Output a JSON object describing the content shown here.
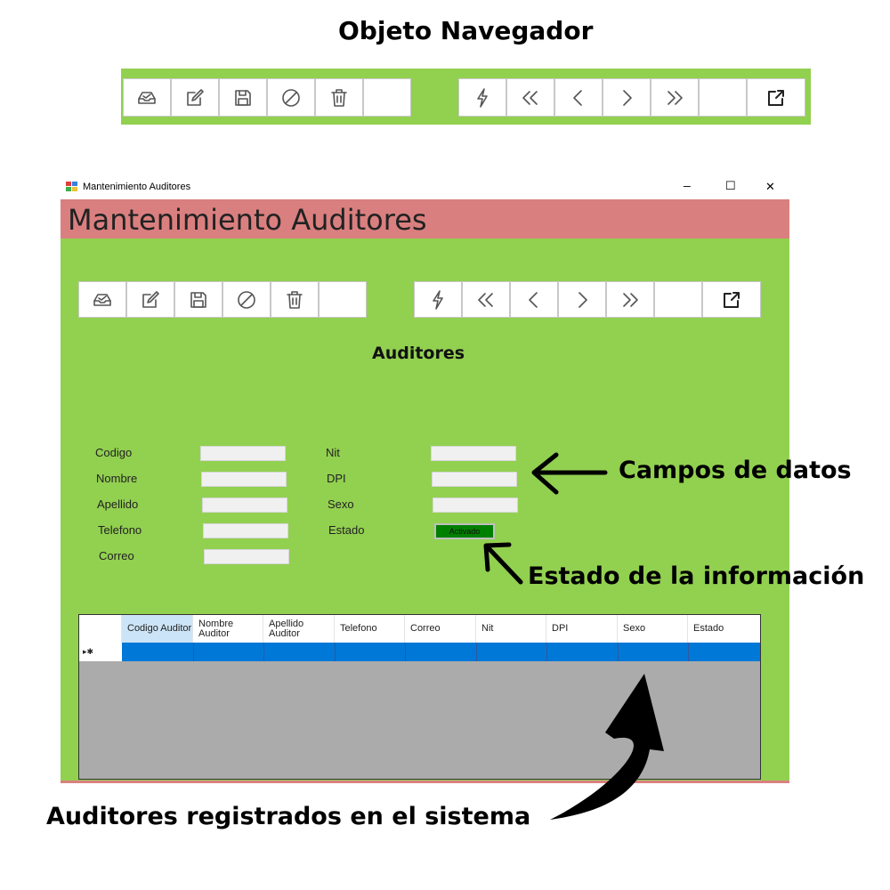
{
  "annotations": {
    "navigator_title": "Objeto Navegador",
    "fields_label": "Campos de datos",
    "state_label": "Estado de la información",
    "grid_label": "Auditores registrados en el sistema"
  },
  "toolbar": {
    "left_buttons": [
      {
        "icon": "inbox-icon"
      },
      {
        "icon": "edit-icon"
      },
      {
        "icon": "save-icon"
      },
      {
        "icon": "cancel-icon"
      },
      {
        "icon": "trash-icon"
      },
      {
        "icon": ""
      }
    ],
    "right_buttons": [
      {
        "icon": "refresh-icon"
      },
      {
        "icon": "first-icon"
      },
      {
        "icon": "previous-icon"
      },
      {
        "icon": "next-icon"
      },
      {
        "icon": "last-icon"
      },
      {
        "icon": ""
      },
      {
        "icon": "external-link-icon"
      }
    ]
  },
  "window": {
    "title": "Mantenimiento Auditores",
    "header_title": "Mantenimiento Auditores",
    "section_title": "Auditores",
    "controls": {
      "minimize": "–",
      "maximize": "☐",
      "close": "✕"
    }
  },
  "form": {
    "left_labels": [
      "Codigo",
      "Nombre",
      "Apellido",
      "Telefono",
      "Correo"
    ],
    "right_labels": [
      "Nit",
      "DPI",
      "Sexo",
      "Estado"
    ],
    "estado_button": "Activado"
  },
  "grid": {
    "columns": [
      "Codigo Auditor",
      "Nombre Auditor",
      "Apellido Auditor",
      "Telefono",
      "Correo",
      "Nit",
      "DPI",
      "Sexo",
      "Estado"
    ],
    "row_indicator": "▸✱"
  },
  "colors": {
    "green": "#92d050",
    "header_red": "#da7f7f",
    "selection_blue": "#0078d7",
    "estado_green": "#008000"
  }
}
